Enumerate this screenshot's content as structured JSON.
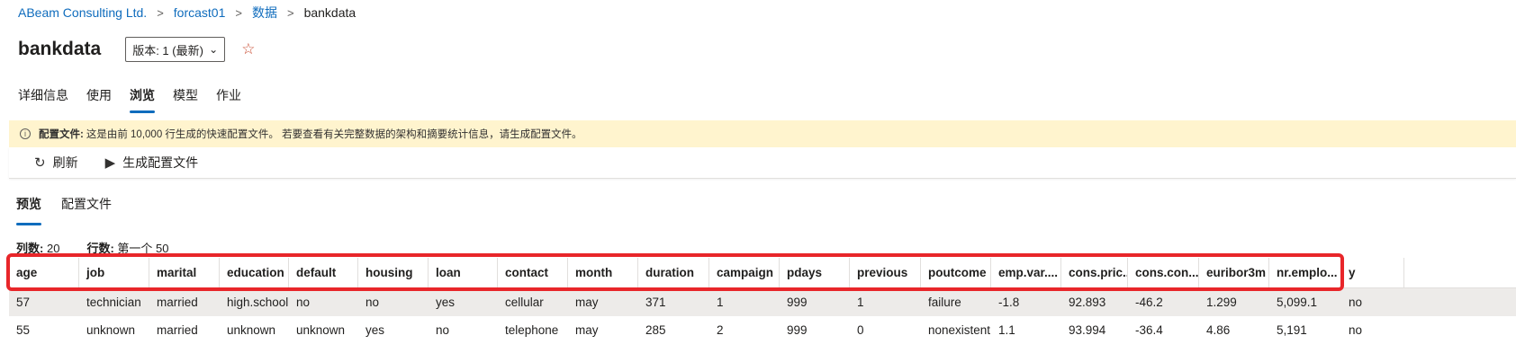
{
  "breadcrumb": {
    "items": [
      "ABeam Consulting Ltd.",
      "forcast01",
      "数据"
    ],
    "current": "bankdata"
  },
  "header": {
    "title": "bankdata",
    "version_label": "版本: 1 (最新)"
  },
  "tabs": [
    "详细信息",
    "使用",
    "浏览",
    "模型",
    "作业"
  ],
  "active_tab": "浏览",
  "banner": {
    "label": "配置文件:",
    "text": "这是由前 10,000 行生成的快速配置文件。 若要查看有关完整数据的架构和摘要统计信息，请生成配置文件。"
  },
  "toolbar": {
    "refresh_label": "刷新",
    "generate_label": "生成配置文件"
  },
  "subtabs": [
    "预览",
    "配置文件"
  ],
  "active_subtab": "预览",
  "counts": {
    "columns_label": "列数:",
    "columns_value": "20",
    "rows_label": "行数:",
    "rows_value": "第一个 50"
  },
  "table": {
    "columns": [
      "age",
      "job",
      "marital",
      "education",
      "default",
      "housing",
      "loan",
      "contact",
      "month",
      "duration",
      "campaign",
      "pdays",
      "previous",
      "poutcome",
      "emp.var....",
      "cons.pric...",
      "cons.con...",
      "euribor3m",
      "nr.emplo...",
      "y"
    ],
    "rows": [
      [
        "57",
        "technician",
        "married",
        "high.school",
        "no",
        "no",
        "yes",
        "cellular",
        "may",
        "371",
        "1",
        "999",
        "1",
        "failure",
        "-1.8",
        "92.893",
        "-46.2",
        "1.299",
        "5,099.1",
        "no"
      ],
      [
        "55",
        "unknown",
        "married",
        "unknown",
        "unknown",
        "yes",
        "no",
        "telephone",
        "may",
        "285",
        "2",
        "999",
        "0",
        "nonexistent",
        "1.1",
        "93.994",
        "-36.4",
        "4.86",
        "5,191",
        "no"
      ]
    ]
  },
  "colors": {
    "accent": "#0f6cbd",
    "banner_bg": "#fff4ce",
    "highlight": "#e8262a",
    "star": "#c84b31"
  }
}
